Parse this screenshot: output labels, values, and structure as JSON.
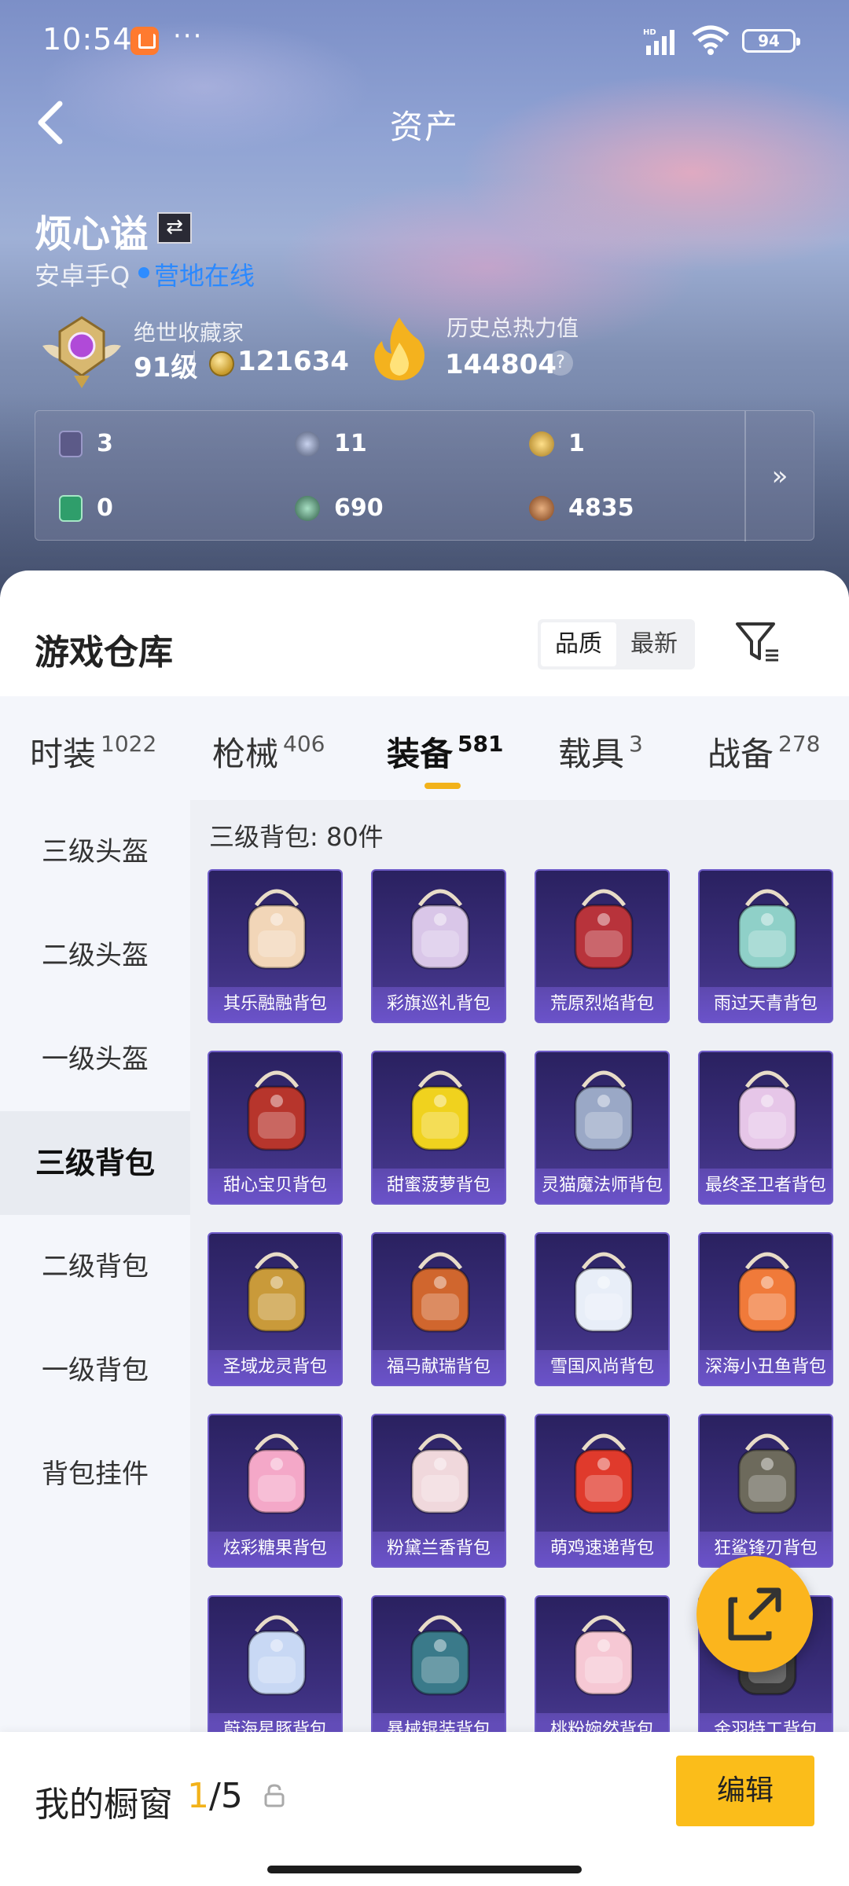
{
  "status_bar": {
    "time": "10:54",
    "more": "···",
    "hd": "HD",
    "battery": "94"
  },
  "nav": {
    "title": "资产"
  },
  "profile": {
    "name": "烦心谥",
    "platform": "安卓手Q",
    "online": "营地在线",
    "rank_title": "绝世收藏家",
    "level": "91级",
    "coins": "121634",
    "heat_title": "历史总热力值",
    "heat_value": "144804",
    "help": "?"
  },
  "stats": [
    {
      "value": "3",
      "icon": "card-icon",
      "color": "#5c5a88"
    },
    {
      "value": "11",
      "icon": "medal-icon",
      "color": "#7c8ab0"
    },
    {
      "value": "1",
      "icon": "gold-token-icon",
      "color": "#caa23a"
    },
    {
      "value": "0",
      "icon": "ticket-icon",
      "color": "#2f9e6b"
    },
    {
      "value": "690",
      "icon": "gem-icon",
      "color": "#4f8a6c"
    },
    {
      "value": "4835",
      "icon": "bronze-coin-icon",
      "color": "#a8663a"
    }
  ],
  "stats_more": "»",
  "warehouse": {
    "title": "游戏仓库",
    "sort_options": [
      "品质",
      "最新"
    ],
    "tabs": [
      {
        "label": "时装",
        "count": "1022"
      },
      {
        "label": "枪械",
        "count": "406"
      },
      {
        "label": "装备",
        "count": "581"
      },
      {
        "label": "载具",
        "count": "3"
      },
      {
        "label": "战备",
        "count": "278"
      }
    ],
    "categories": [
      "三级头盔",
      "二级头盔",
      "一级头盔",
      "三级背包",
      "二级背包",
      "一级背包",
      "背包挂件"
    ],
    "section_label": "三级背包: 80件",
    "items": [
      {
        "name": "其乐融融背包",
        "color": "#f2d6b8"
      },
      {
        "name": "彩旗巡礼背包",
        "color": "#d9c6e8"
      },
      {
        "name": "荒原烈焰背包",
        "color": "#b8333b"
      },
      {
        "name": "雨过天青背包",
        "color": "#8fd0c8"
      },
      {
        "name": "甜心宝贝背包",
        "color": "#b7352c"
      },
      {
        "name": "甜蜜菠萝背包",
        "color": "#f0d21e"
      },
      {
        "name": "灵猫魔法师背包",
        "color": "#9aa8c6"
      },
      {
        "name": "最终圣卫者背包",
        "color": "#e6c6e8"
      },
      {
        "name": "圣域龙灵背包",
        "color": "#c99a3a"
      },
      {
        "name": "福马献瑞背包",
        "color": "#d0662e"
      },
      {
        "name": "雪国风尚背包",
        "color": "#e8eef8"
      },
      {
        "name": "深海小丑鱼背包",
        "color": "#f07a3a"
      },
      {
        "name": "炫彩糖果背包",
        "color": "#f4a8c8"
      },
      {
        "name": "粉黛兰香背包",
        "color": "#f0d8dc"
      },
      {
        "name": "萌鸡速递背包",
        "color": "#e03a2c"
      },
      {
        "name": "狂鲨锋刃背包",
        "color": "#6d6a5c"
      },
      {
        "name": "蔚海星豚背包",
        "color": "#c8d8f4"
      },
      {
        "name": "暴械锟装背包",
        "color": "#3a7a8a"
      },
      {
        "name": "桃粉婉然背包",
        "color": "#f6c8d4"
      },
      {
        "name": "金羽特工背包",
        "color": "#3a3a3a"
      }
    ]
  },
  "bottom": {
    "label": "我的橱窗",
    "current": "1",
    "total": "/5",
    "edit": "编辑"
  }
}
